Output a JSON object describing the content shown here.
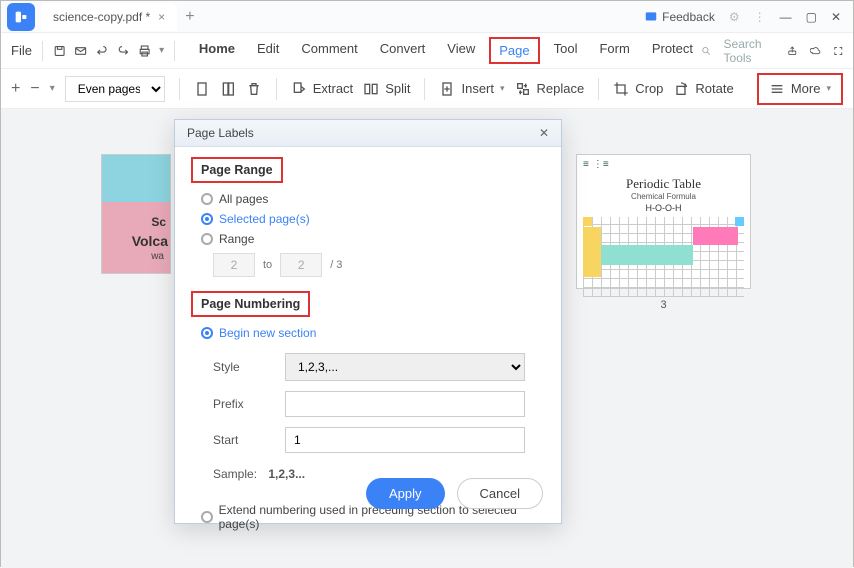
{
  "titlebar": {
    "tab_title": "science-copy.pdf *",
    "feedback": "Feedback"
  },
  "menubar": {
    "file": "File",
    "tabs": [
      "Home",
      "Edit",
      "Comment",
      "Convert",
      "View",
      "Page",
      "Tool",
      "Form",
      "Protect"
    ],
    "active_index": 5,
    "search_placeholder": "Search Tools"
  },
  "toolbar": {
    "page_selector": "Even pages",
    "extract": "Extract",
    "split": "Split",
    "insert": "Insert",
    "replace": "Replace",
    "crop": "Crop",
    "rotate": "Rotate",
    "more": "More"
  },
  "thumbs": {
    "thumb1": {
      "t1": "Sc",
      "t2": "Volca",
      "t3": "wa"
    },
    "thumb3": {
      "title": "Periodic Table",
      "subtitle": "Chemical Formula",
      "formula": "H-O-O-H"
    },
    "page3_label": "3"
  },
  "dialog": {
    "title": "Page Labels",
    "page_range_header": "Page Range",
    "all_pages": "All pages",
    "selected_pages": "Selected page(s)",
    "range": "Range",
    "range_from": "2",
    "range_to_label": "to",
    "range_to": "2",
    "range_total": "/ 3",
    "page_numbering_header": "Page Numbering",
    "begin_section": "Begin new section",
    "style_label": "Style",
    "style_value": "1,2,3,...",
    "prefix_label": "Prefix",
    "prefix_value": "",
    "start_label": "Start",
    "start_value": "1",
    "sample_label": "Sample:",
    "sample_value": "1,2,3...",
    "extend": "Extend numbering used in preceding section to selected page(s)",
    "apply": "Apply",
    "cancel": "Cancel"
  }
}
